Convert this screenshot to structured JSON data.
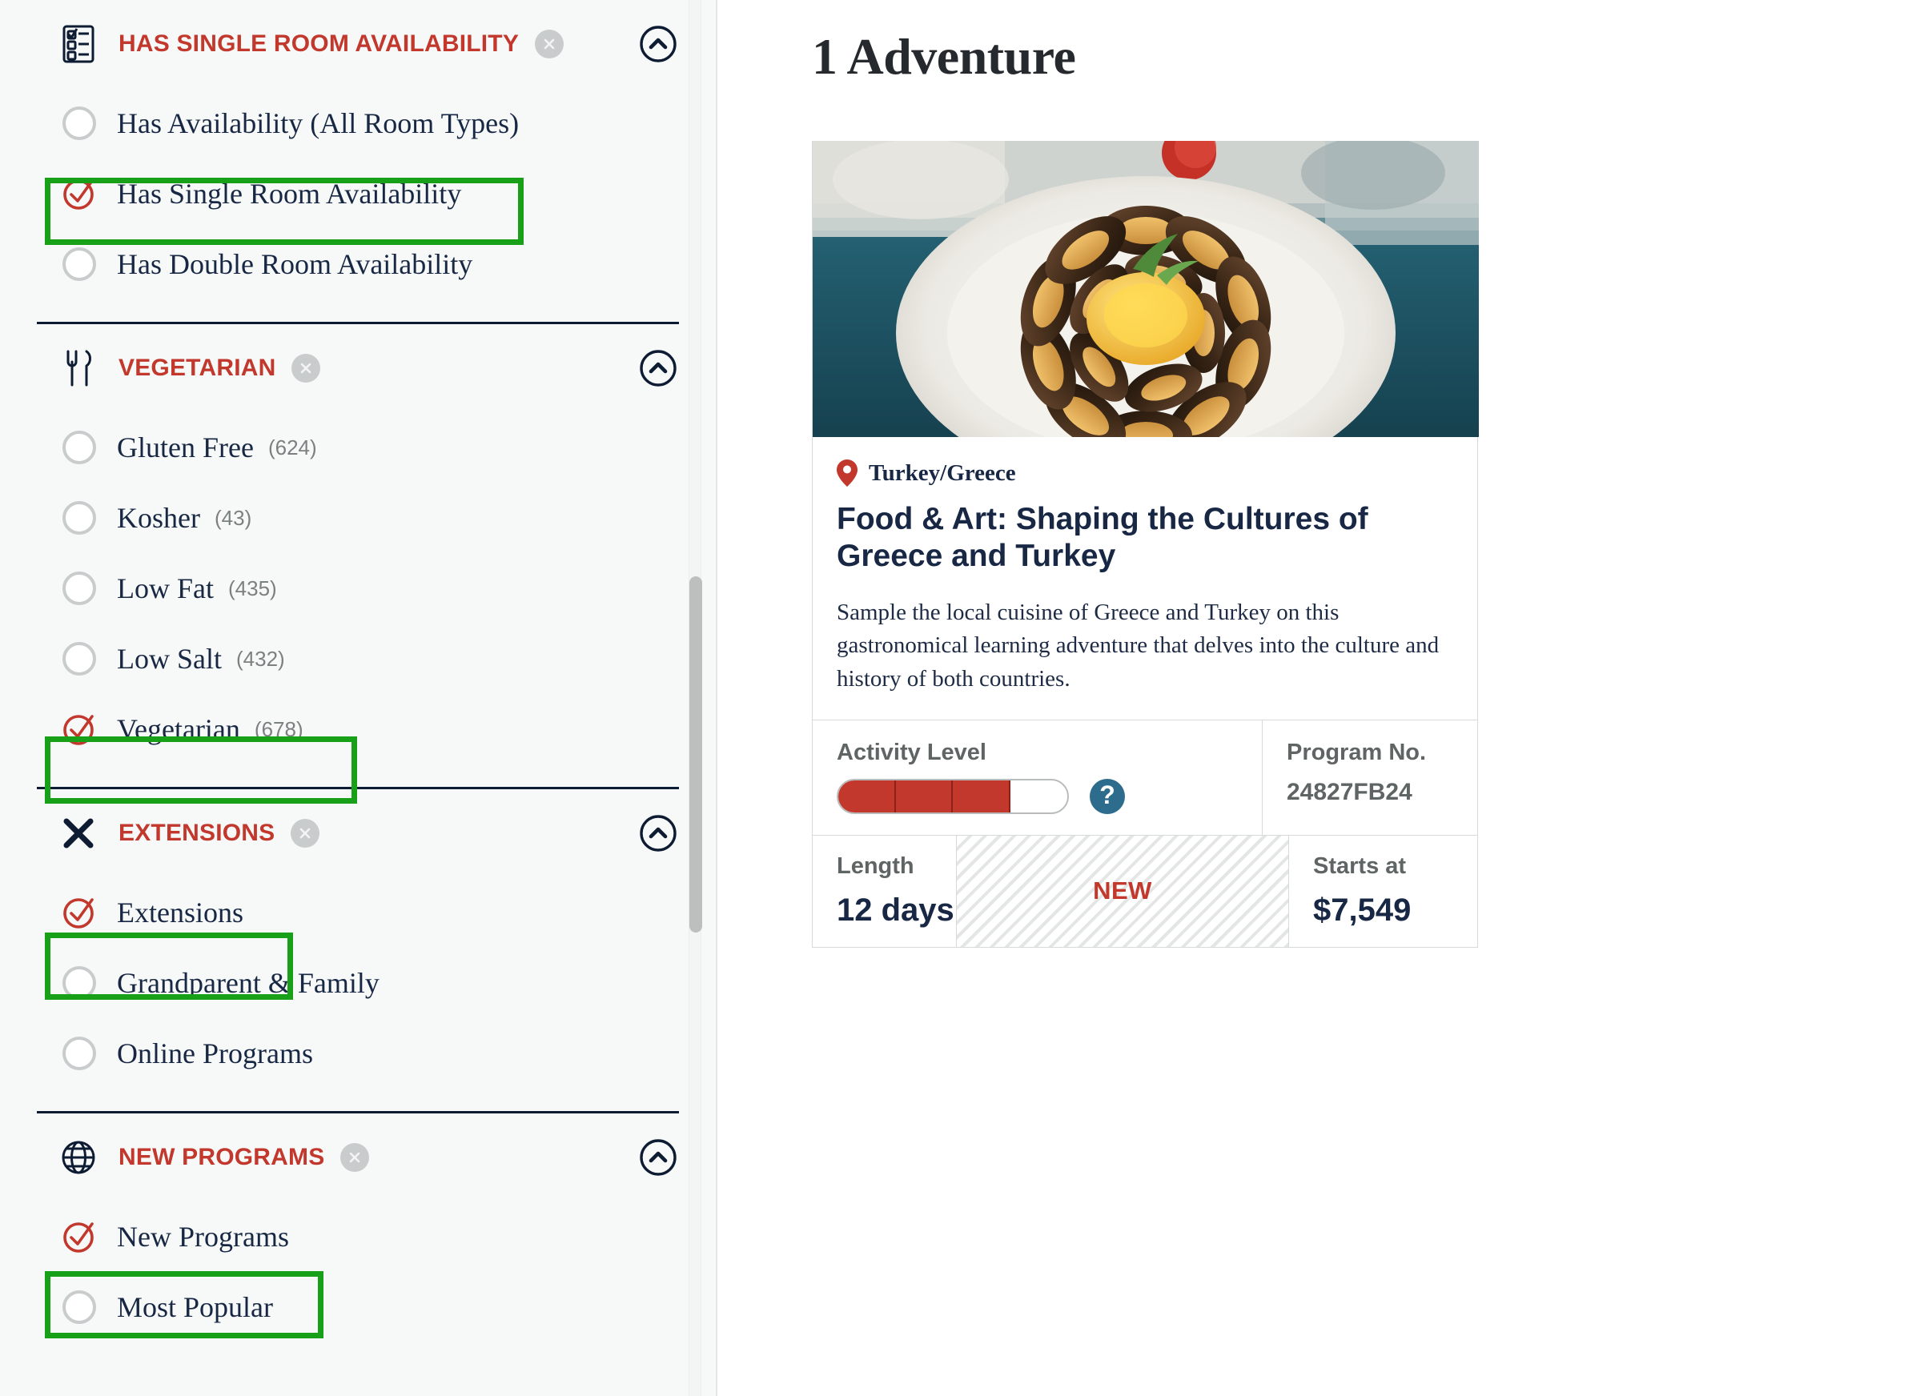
{
  "sidebar": {
    "facets": [
      {
        "id": "has-single-room-availability",
        "title": "HAS SINGLE ROOM AVAILABILITY",
        "icon": "checklist-icon",
        "clear_label": "x",
        "collapse_label": "chevron-up-icon",
        "options": [
          {
            "label": "Has Availability (All Room Types)",
            "count": "",
            "checked": false,
            "highlighted": false
          },
          {
            "label": "Has Single Room Availability",
            "count": "",
            "checked": true,
            "highlighted": true
          },
          {
            "label": "Has Double Room Availability",
            "count": "",
            "checked": false,
            "highlighted": false
          }
        ]
      },
      {
        "id": "vegetarian",
        "title": "VEGETARIAN",
        "icon": "fork-knife-icon",
        "clear_label": "x",
        "collapse_label": "chevron-up-icon",
        "options": [
          {
            "label": "Gluten Free",
            "count": "(624)",
            "checked": false,
            "highlighted": false
          },
          {
            "label": "Kosher",
            "count": "(43)",
            "checked": false,
            "highlighted": false
          },
          {
            "label": "Low Fat",
            "count": "(435)",
            "checked": false,
            "highlighted": false
          },
          {
            "label": "Low Salt",
            "count": "(432)",
            "checked": false,
            "highlighted": false
          },
          {
            "label": "Vegetarian",
            "count": "(678)",
            "checked": true,
            "highlighted": true
          }
        ]
      },
      {
        "id": "extensions",
        "title": "EXTENSIONS",
        "icon": "x-mark-icon",
        "clear_label": "x",
        "collapse_label": "chevron-up-icon",
        "options": [
          {
            "label": "Extensions",
            "count": "",
            "checked": true,
            "highlighted": true
          },
          {
            "label": "Grandparent & Family",
            "count": "",
            "checked": false,
            "highlighted": false
          },
          {
            "label": "Online Programs",
            "count": "",
            "checked": false,
            "highlighted": false
          }
        ]
      },
      {
        "id": "new-programs",
        "title": "NEW PROGRAMS",
        "icon": "globe-icon",
        "clear_label": "x",
        "collapse_label": "chevron-up-icon",
        "options": [
          {
            "label": "New Programs",
            "count": "",
            "checked": true,
            "highlighted": true
          },
          {
            "label": "Most Popular",
            "count": "",
            "checked": false,
            "highlighted": false
          }
        ]
      }
    ]
  },
  "main": {
    "results_heading": "1 Adventure",
    "card": {
      "photo_alt": "plate-of-mussels-photo",
      "location": "Turkey/Greece",
      "title": "Food & Art: Shaping the Cultures of Greece and Turkey",
      "description": "Sample the local cuisine of Greece and Turkey on this gastronomical learning adventure that delves into the culture and history of both countries.",
      "activity_label": "Activity Level",
      "activity_level_filled": 3,
      "activity_level_total": 4,
      "help_label": "?",
      "program_no_label": "Program No.",
      "program_no_value": "24827FB24",
      "length_label": "Length",
      "length_value": "12 days",
      "new_badge": "NEW",
      "price_label": "Starts at",
      "price_value": "$7,549"
    }
  },
  "colors": {
    "accent_red": "#c2382c",
    "navy": "#182844",
    "highlight_green": "#18a018",
    "help_blue": "#2d6c8c",
    "muted_gray": "#7b8181"
  }
}
